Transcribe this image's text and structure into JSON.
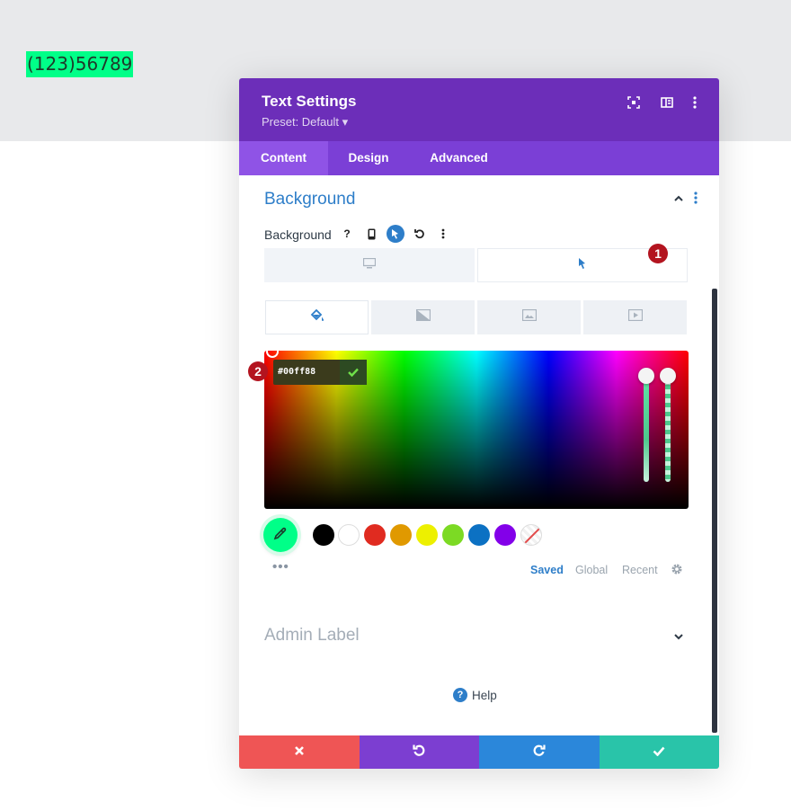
{
  "page": {
    "sample_text": "(123)56789"
  },
  "modal": {
    "title": "Text Settings",
    "preset": "Preset: Default ▾",
    "header_icons": [
      "fullscreen-icon",
      "split-view-icon",
      "more-options-icon"
    ]
  },
  "tabs": [
    {
      "label": "Content",
      "active": true
    },
    {
      "label": "Design",
      "active": false
    },
    {
      "label": "Advanced",
      "active": false
    }
  ],
  "section": {
    "title": "Background",
    "field_label": "Background",
    "tools": [
      "help-icon",
      "responsive-icon",
      "hover-icon",
      "reset-icon",
      "more-icon"
    ],
    "mode_toggles": [
      "desktop-icon",
      "hover-cursor-icon"
    ],
    "type_tabs": [
      "color-icon",
      "gradient-icon",
      "image-icon",
      "video-icon"
    ]
  },
  "annotations": {
    "badge_1": "1",
    "badge_2": "2"
  },
  "color_picker": {
    "hex_value": "#00ff88",
    "current_color": "#00ff88",
    "swatches": [
      {
        "name": "black",
        "color": "#000000"
      },
      {
        "name": "white",
        "color": "#ffffff"
      },
      {
        "name": "red",
        "color": "#e02b20"
      },
      {
        "name": "orange",
        "color": "#e09900"
      },
      {
        "name": "yellow",
        "color": "#edf000"
      },
      {
        "name": "green",
        "color": "#7cda24"
      },
      {
        "name": "blue",
        "color": "#0c71c3"
      },
      {
        "name": "purple",
        "color": "#8300e9"
      },
      {
        "name": "none",
        "color": "transparent"
      }
    ],
    "more_label": "•••",
    "library_tabs": [
      "Saved",
      "Global",
      "Recent"
    ],
    "active_library_tab": "Saved"
  },
  "admin_label": {
    "title": "Admin Label"
  },
  "help": {
    "label": "Help"
  },
  "footer": {
    "buttons": [
      {
        "name": "discard",
        "color": "#ef5555"
      },
      {
        "name": "undo",
        "color": "#7c3ed1"
      },
      {
        "name": "redo",
        "color": "#2b87da"
      },
      {
        "name": "save",
        "color": "#29c4a9"
      }
    ]
  }
}
